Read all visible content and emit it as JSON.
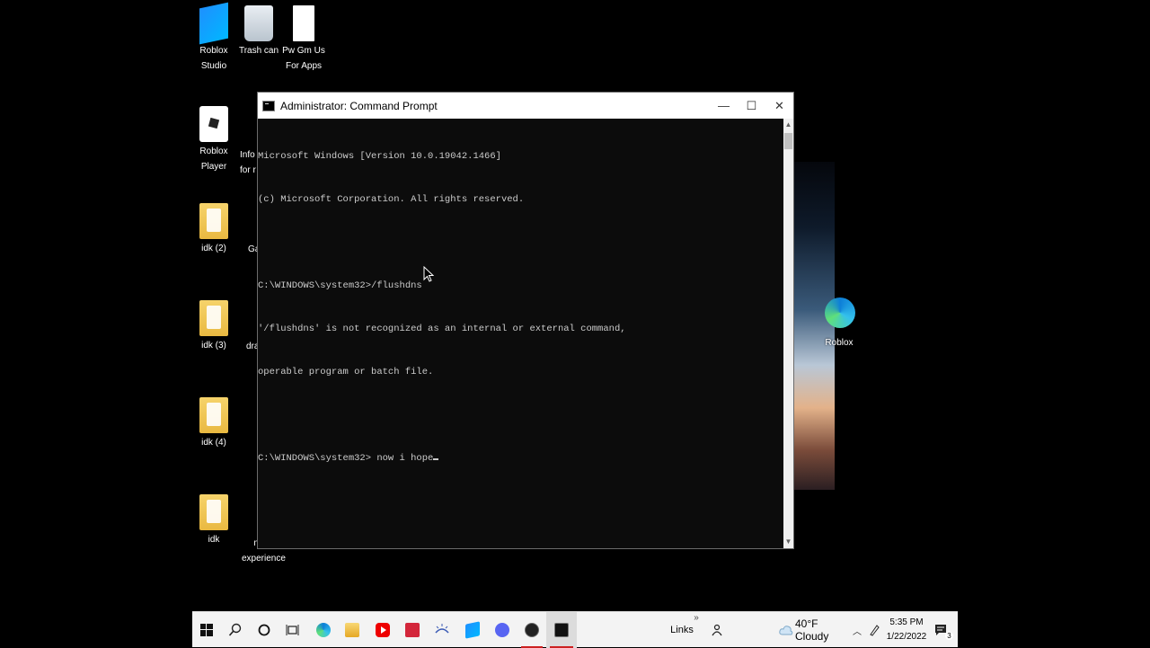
{
  "desktop_icons": {
    "roblox_studio": "Roblox\nStudio",
    "trash_can": "Trash can",
    "pw_gm_us": "Pw Gm Us\nFor Apps",
    "roblox_player": "Roblox Player",
    "idk2": "idk (2)",
    "idk3": "idk (3)",
    "idk4": "idk (4)",
    "idk": "idk",
    "roblox_edge": "Roblox",
    "partial_info": "Info\nfor r",
    "partial_ga": "Ga",
    "partial_dra": "dra",
    "partial_my": "my\nexperience"
  },
  "cmd_window": {
    "title": "Administrator: Command Prompt",
    "minimize": "—",
    "maximize": "☐",
    "close": "✕",
    "lines": [
      "Microsoft Windows [Version 10.0.19042.1466]",
      "(c) Microsoft Corporation. All rights reserved.",
      "",
      "C:\\WINDOWS\\system32>/flushdns",
      "'/flushdns' is not recognized as an internal or external command,",
      "operable program or batch file.",
      "",
      "C:\\WINDOWS\\system32> now i hope"
    ]
  },
  "taskbar": {
    "links": "Links",
    "chevron": "»",
    "weather": "40°F Cloudy",
    "time": "5:35 PM",
    "date": "1/22/2022",
    "notification_count": "3"
  }
}
